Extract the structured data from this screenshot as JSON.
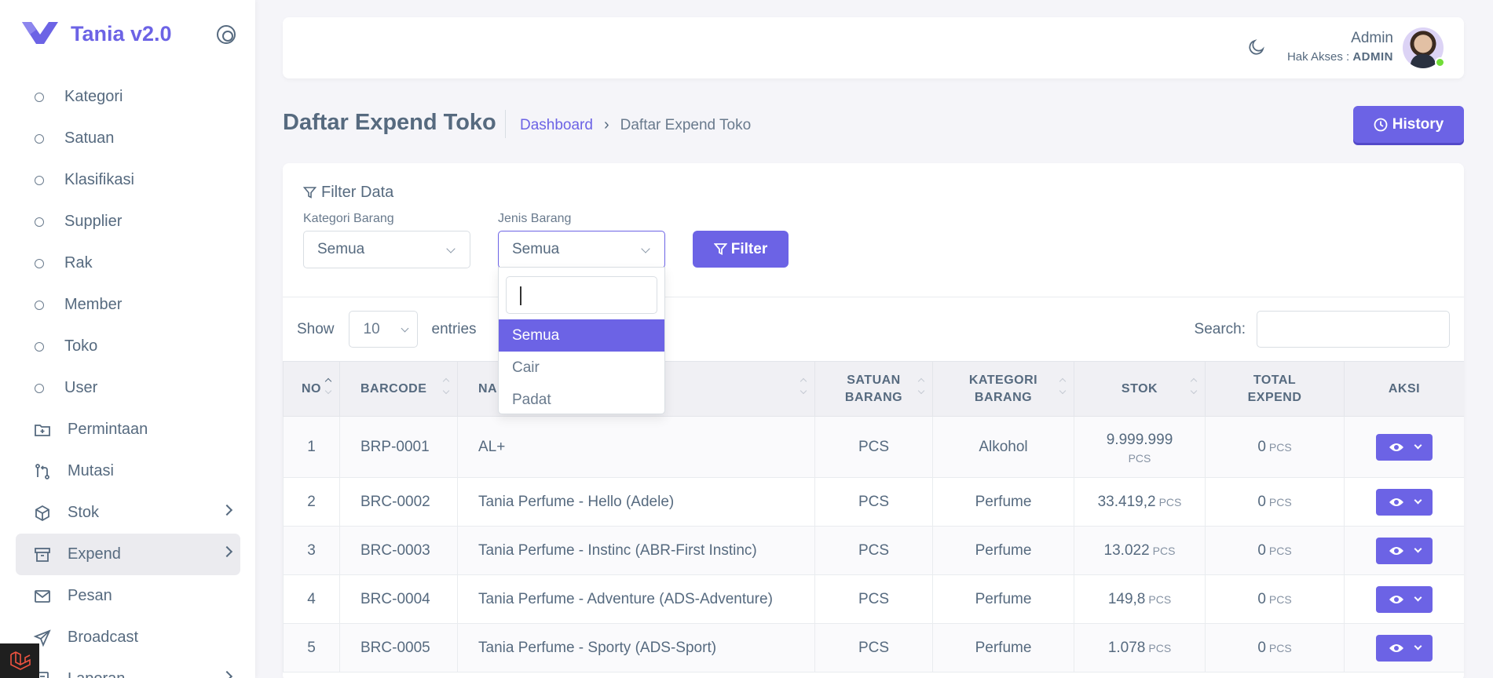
{
  "app": {
    "title": "Tania v2.0"
  },
  "sidebar": {
    "items": [
      {
        "label": "Kategori",
        "icon": "circle-icon"
      },
      {
        "label": "Satuan",
        "icon": "circle-icon"
      },
      {
        "label": "Klasifikasi",
        "icon": "circle-icon"
      },
      {
        "label": "Supplier",
        "icon": "circle-icon"
      },
      {
        "label": "Rak",
        "icon": "circle-icon"
      },
      {
        "label": "Member",
        "icon": "circle-icon"
      },
      {
        "label": "Toko",
        "icon": "circle-icon"
      },
      {
        "label": "User",
        "icon": "circle-icon"
      },
      {
        "label": "Permintaan",
        "icon": "folder-plus-icon"
      },
      {
        "label": "Mutasi",
        "icon": "git-compare-icon"
      },
      {
        "label": "Stok",
        "icon": "box-icon",
        "submenu": true
      },
      {
        "label": "Expend",
        "icon": "archive-icon",
        "submenu": true,
        "active": true
      },
      {
        "label": "Pesan",
        "icon": "mail-icon"
      },
      {
        "label": "Broadcast",
        "icon": "send-icon"
      },
      {
        "label": "Laporan",
        "icon": "report-icon",
        "submenu": true
      }
    ]
  },
  "navbar": {
    "user_name": "Admin",
    "role_prefix": "Hak Akses : ",
    "role": "ADMIN"
  },
  "page": {
    "title": "Daftar Expend Toko",
    "breadcrumb": {
      "home": "Dashboard",
      "separator": "›",
      "current": "Daftar Expend Toko"
    },
    "history_label": "History"
  },
  "filter": {
    "title": "Filter Data",
    "kategori_label": "Kategori Barang",
    "kategori_value": "Semua",
    "jenis_label": "Jenis Barang",
    "jenis_value": "Semua",
    "button_label": "Filter",
    "dropdown_options": [
      "Semua",
      "Cair",
      "Padat"
    ],
    "dropdown_selected": "Semua"
  },
  "datatable": {
    "show_label": "Show",
    "length_value": "10",
    "entries_label": "entries",
    "search_label": "Search:",
    "columns": [
      "NO",
      "BARCODE",
      "NAMA BARANG",
      "SATUAN BARANG",
      "KATEGORI BARANG",
      "STOK",
      "TOTAL EXPEND",
      "AKSI"
    ],
    "rows": [
      {
        "no": "1",
        "barcode": "BRP-0001",
        "nama": "AL+",
        "satuan": "PCS",
        "kategori": "Alkohol",
        "stok": "9.999.999",
        "stok_unit": "PCS",
        "expend": "0",
        "expend_unit": "PCS"
      },
      {
        "no": "2",
        "barcode": "BRC-0002",
        "nama": "Tania Perfume - Hello (Adele)",
        "satuan": "PCS",
        "kategori": "Perfume",
        "stok": "33.419,2",
        "stok_unit": "PCS",
        "expend": "0",
        "expend_unit": "PCS"
      },
      {
        "no": "3",
        "barcode": "BRC-0003",
        "nama": "Tania Perfume - Instinc (ABR-First Instinc)",
        "satuan": "PCS",
        "kategori": "Perfume",
        "stok": "13.022",
        "stok_unit": "PCS",
        "expend": "0",
        "expend_unit": "PCS"
      },
      {
        "no": "4",
        "barcode": "BRC-0004",
        "nama": "Tania Perfume - Adventure (ADS-Adventure)",
        "satuan": "PCS",
        "kategori": "Perfume",
        "stok": "149,8",
        "stok_unit": "PCS",
        "expend": "0",
        "expend_unit": "PCS"
      },
      {
        "no": "5",
        "barcode": "BRC-0005",
        "nama": "Tania Perfume - Sporty (ADS-Sport)",
        "satuan": "PCS",
        "kategori": "Perfume",
        "stok": "1.078",
        "stok_unit": "PCS",
        "expend": "0",
        "expend_unit": "PCS"
      }
    ]
  },
  "colors": {
    "accent": "#6c63e5",
    "text": "#566a7f",
    "background": "#f5f5f9",
    "online": "#71dd37"
  }
}
